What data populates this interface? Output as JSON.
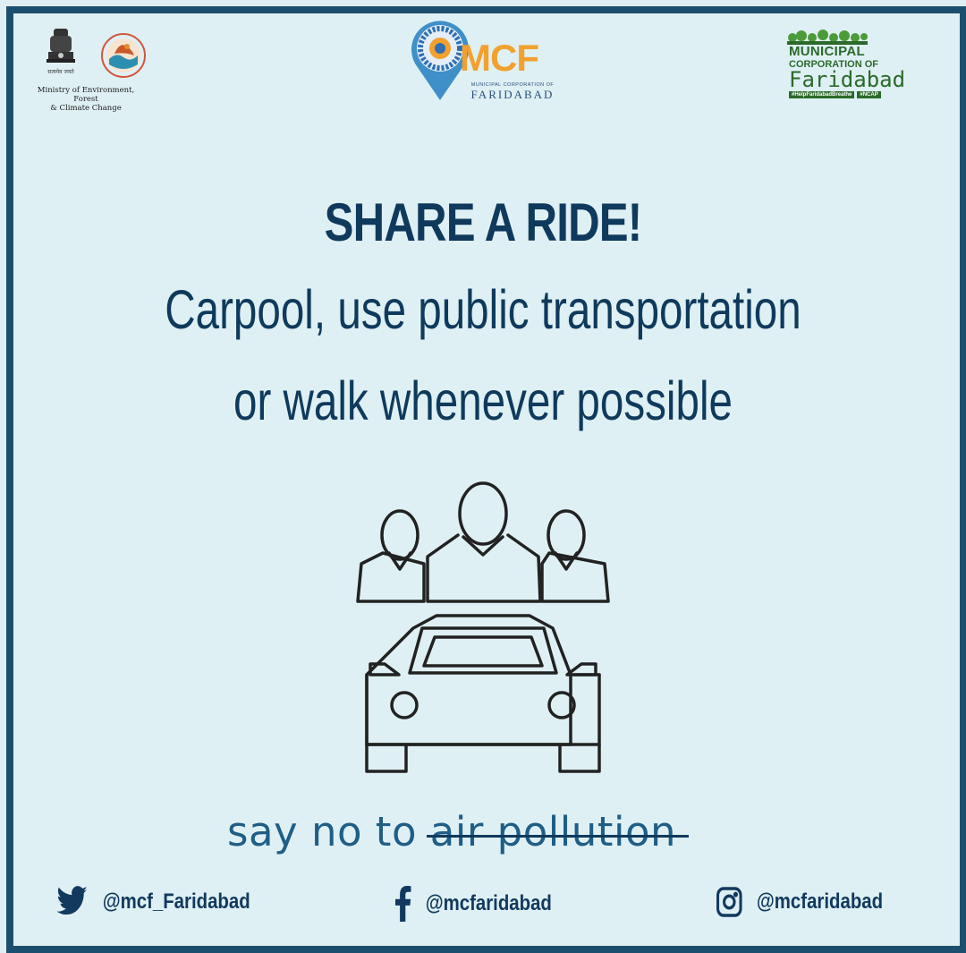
{
  "logos": {
    "ministry_text_line1": "Ministry of Environment, Forest",
    "ministry_text_line2": "& Climate Change",
    "mcf_abbrev": "MCF",
    "mcf_small": "MUNICIPAL CORPORATION OF",
    "mcf_city": "FARIDABAD",
    "mcfr_line1": "MUNICIPAL",
    "mcfr_line2": "CORPORATION OF",
    "mcfr_line3": "Faridabad",
    "mcfr_tag1": "#HelpFaridabadBreathe",
    "mcfr_tag2": "#NCAP"
  },
  "headline": {
    "title": "SHARE A RIDE!",
    "line1": "Carpool, use public transportation",
    "line2": "or walk whenever possible"
  },
  "slogan": {
    "plain": "say no to ",
    "struck": "air pollution"
  },
  "social": {
    "twitter": "@mcf_Faridabad",
    "facebook": "@mcfaridabad",
    "instagram": "@mcfaridabad"
  },
  "colors": {
    "primary": "#0f3a5c",
    "accent": "#1f5e86",
    "background": "#dff0f4",
    "border": "#1c4f6e"
  },
  "icons": [
    "ashoka-emblem-icon",
    "moefcc-logo-icon",
    "mcf-pin-logo-icon",
    "people-icon",
    "car-icon",
    "twitter-icon",
    "facebook-icon",
    "instagram-icon"
  ]
}
